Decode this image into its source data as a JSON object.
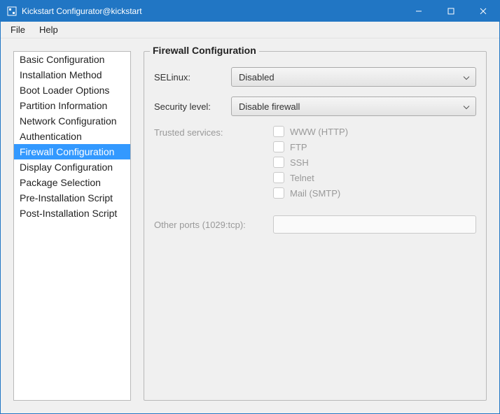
{
  "window": {
    "title": "Kickstart Configurator@kickstart"
  },
  "menubar": {
    "file": "File",
    "help": "Help"
  },
  "sidebar": {
    "items": [
      "Basic Configuration",
      "Installation Method",
      "Boot Loader Options",
      "Partition Information",
      "Network Configuration",
      "Authentication",
      "Firewall Configuration",
      "Display Configuration",
      "Package Selection",
      "Pre-Installation Script",
      "Post-Installation Script"
    ],
    "selected_index": 6
  },
  "panel": {
    "legend": "Firewall Configuration",
    "selinux_label": "SELinux:",
    "selinux_value": "Disabled",
    "seclevel_label": "Security level:",
    "seclevel_value": "Disable firewall",
    "trusted_label": "Trusted services:",
    "services": [
      "WWW (HTTP)",
      "FTP",
      "SSH",
      "Telnet",
      "Mail (SMTP)"
    ],
    "ports_label": "Other ports (1029:tcp):",
    "ports_value": ""
  }
}
